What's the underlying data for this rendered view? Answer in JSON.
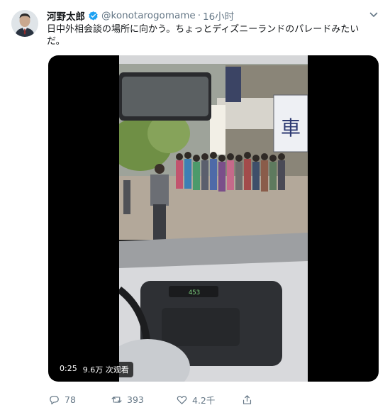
{
  "tweet": {
    "display_name": "河野太郎",
    "handle": "@konotarogomame",
    "separator": "·",
    "time": "16小时",
    "text": "日中外相会談の場所に向かう。ちょっとディズニーランドのパレードみたいだ。",
    "accent_color": "#1da1f2"
  },
  "video": {
    "duration": "0:25",
    "views": "9.6万 次观看",
    "sign_text": "車"
  },
  "actions": {
    "reply_count": "78",
    "retweet_count": "393",
    "like_count": "4.2千"
  },
  "icons": [
    "verified-badge-icon",
    "chevron-down-icon",
    "reply-icon",
    "retweet-icon",
    "like-icon",
    "share-icon"
  ]
}
